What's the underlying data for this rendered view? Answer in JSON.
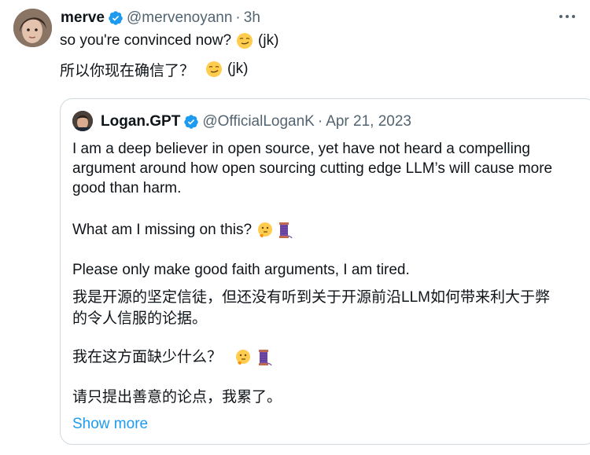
{
  "tweet": {
    "author_name": "merve",
    "author_handle": "@mervenoyann",
    "separator": "·",
    "time": "3h",
    "text_en": "so you're convinced now?",
    "text_en_suffix": "(jk)",
    "text_zh": "所以你现在确信了？",
    "text_zh_suffix": "(jk)",
    "emoji": "smirking-face"
  },
  "quote": {
    "author_name": "Logan.GPT",
    "author_handle": "@OfficialLoganK",
    "separator": "·",
    "date": "Apr 21, 2023",
    "para1": "I am a deep believer in open source, yet have not heard a compelling argument around how open sourcing cutting edge LLM’s will cause more good than harm.",
    "para2": "What am I missing on this?",
    "para3": "Please only make good faith arguments, I am tired.",
    "zh1": "我是开源的坚定信徒，但还没有听到关于开源前沿LLM如何带来利大于弊的令人信服的论据。",
    "zh2": "我在这方面缺少什么？",
    "zh3": "请只提出善意的论点，我累了。",
    "show_more": "Show more",
    "emojis": [
      "thinking-face",
      "thread-spool"
    ]
  },
  "colors": {
    "verified": "#1d9bf0",
    "link": "#1d9bf0",
    "muted": "#536471",
    "border": "#cfd9de"
  }
}
